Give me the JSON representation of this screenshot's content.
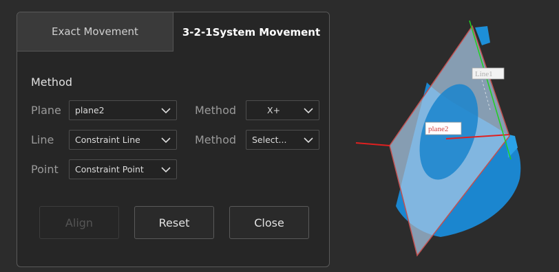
{
  "tabs": [
    {
      "label": "Exact Movement",
      "active": false
    },
    {
      "label": "3-2-1System Movement",
      "active": true
    }
  ],
  "method_section": {
    "title": "Method"
  },
  "rows": {
    "plane": {
      "label": "Plane",
      "value": "plane2",
      "method_label": "Method",
      "method_value": "X+"
    },
    "line": {
      "label": "Line",
      "value": "Constraint Line",
      "method_label": "Method",
      "method_value": "Select..."
    },
    "point": {
      "label": "Point",
      "value": "Constraint Point"
    }
  },
  "buttons": {
    "align": "Align",
    "reset": "Reset",
    "close": "Close"
  },
  "scene": {
    "labels": {
      "line": "Line1",
      "plane": "plane2"
    },
    "colors": {
      "model": "#1d8fd8",
      "plane": "#b9d4ec",
      "axis_red": "#e02020",
      "axis_green": "#20d020"
    }
  }
}
